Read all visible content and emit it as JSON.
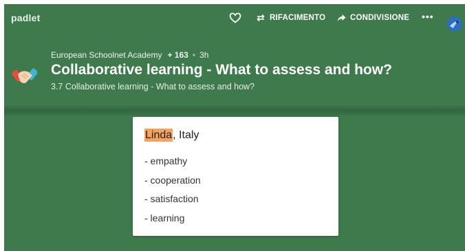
{
  "topbar": {
    "logo": "padlet",
    "remake_label": "RIFACIMENTO",
    "share_label": "CONDIVISIONE",
    "more_label": "•••"
  },
  "header": {
    "author": "European Schoolnet Academy",
    "count": "+ 163",
    "separator": "•",
    "time": "3h",
    "title": "Collaborative learning - What to assess and how?",
    "subtitle": "3.7 Collaborative learning - What to assess and how?"
  },
  "post": {
    "name": "Linda",
    "rest_of_title": ", Italy",
    "items": [
      "- empathy",
      "- cooperation",
      "- satisfaction",
      "- learning"
    ],
    "highlight_color": "#f7a35c"
  },
  "colors": {
    "background": "#3e7a4c",
    "card": "#ffffff"
  }
}
